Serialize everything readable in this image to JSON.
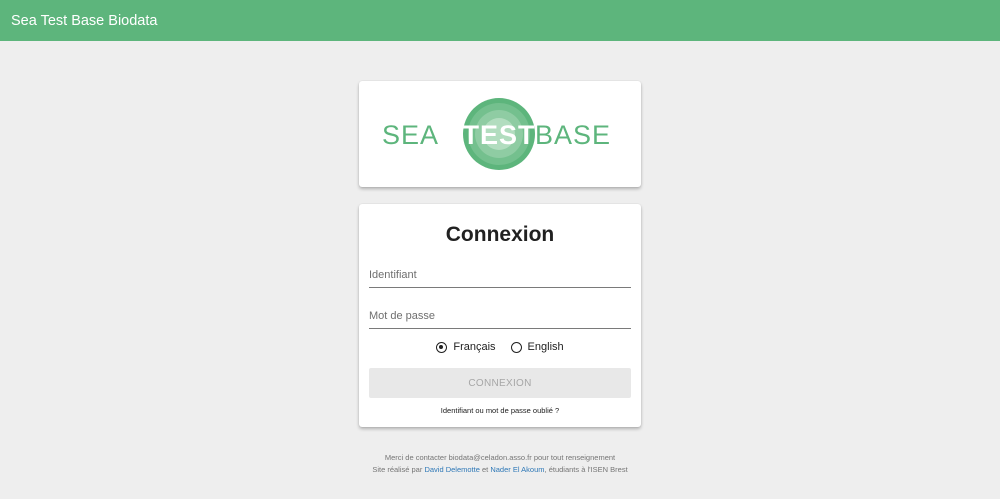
{
  "appbar": {
    "title": "Sea Test Base Biodata"
  },
  "logo": {
    "left_text": "SEA",
    "center_text": "TEST",
    "right_text": "BASE",
    "color": "#5db57c"
  },
  "login": {
    "title": "Connexion",
    "username_placeholder": "Identifiant",
    "password_placeholder": "Mot de passe",
    "languages": [
      {
        "label": "Français",
        "selected": true
      },
      {
        "label": "English",
        "selected": false
      }
    ],
    "submit_label": "CONNEXION",
    "forgot_label": "Identifiant ou mot de passe oublié ?"
  },
  "footer": {
    "line1": "Merci de contacter biodata@celadon.asso.fr pour tout renseignement",
    "line2_prefix": "Site réalisé par ",
    "author1": "David Delemotte",
    "line2_mid": " et ",
    "author2": "Nader El Akoum",
    "line2_suffix": ", étudiants à l'ISEN Brest"
  },
  "colors": {
    "accent": "#5db57c",
    "background": "#eeeeee",
    "link": "#2e78b7"
  }
}
